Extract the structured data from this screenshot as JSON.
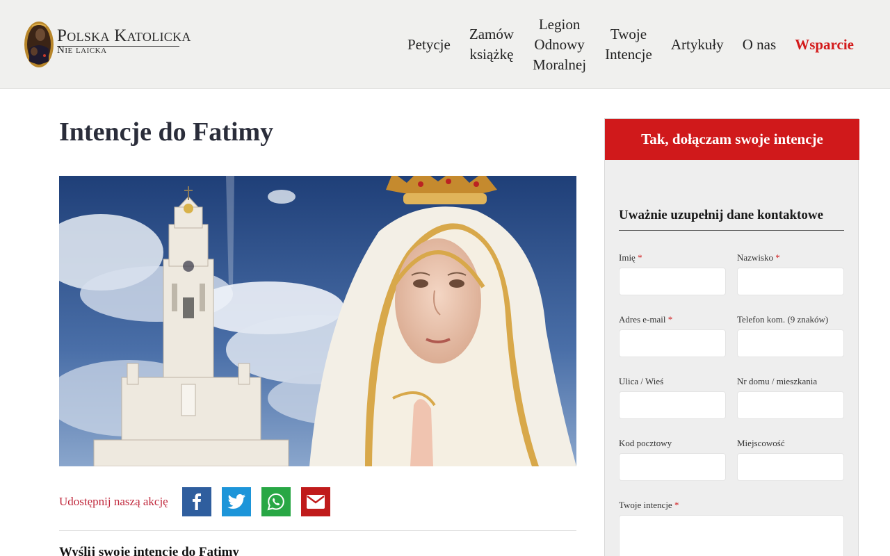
{
  "logo": {
    "title": "Polska Katolicka",
    "subtitle": "Nie laicka"
  },
  "nav": [
    {
      "label": "Petycje"
    },
    {
      "label": "Zamów\nksiążkę"
    },
    {
      "label": "Legion\nOdnowy\nMoralnej"
    },
    {
      "label": "Twoje\nIntencje"
    },
    {
      "label": "Artykuły"
    },
    {
      "label": "O nas"
    },
    {
      "label": "Wsparcie"
    }
  ],
  "main": {
    "title": "Intencje do Fatimy",
    "share_label": "Udostępnij naszą akcję",
    "share_buttons": [
      "facebook-icon",
      "twitter-icon",
      "whatsapp-icon",
      "email-icon"
    ],
    "sub_heading": "Wyślij swoje intencje do Fatimy"
  },
  "sidebar": {
    "header": "Tak, dołączam swoje intencje",
    "form_title": "Uważnie uzupełnij dane kontaktowe",
    "fields": {
      "first_name": {
        "label": "Imię",
        "required": "*"
      },
      "last_name": {
        "label": "Nazwisko",
        "required": "*"
      },
      "email": {
        "label": "Adres e-mail",
        "required": "*"
      },
      "phone": {
        "label": "Telefon kom. (9 znaków)"
      },
      "street": {
        "label": "Ulica / Wieś"
      },
      "house": {
        "label": "Nr domu / mieszkania"
      },
      "postal": {
        "label": "Kod pocztowy"
      },
      "city": {
        "label": "Miejscowość"
      },
      "intentions": {
        "label": "Twoje intencje",
        "required": "*"
      }
    }
  },
  "colors": {
    "accent": "#d0191b",
    "share_label": "#c0283c",
    "facebook": "#2f5e9e",
    "twitter": "#1d95d9",
    "whatsapp": "#28a745",
    "email": "#c01b1b"
  }
}
